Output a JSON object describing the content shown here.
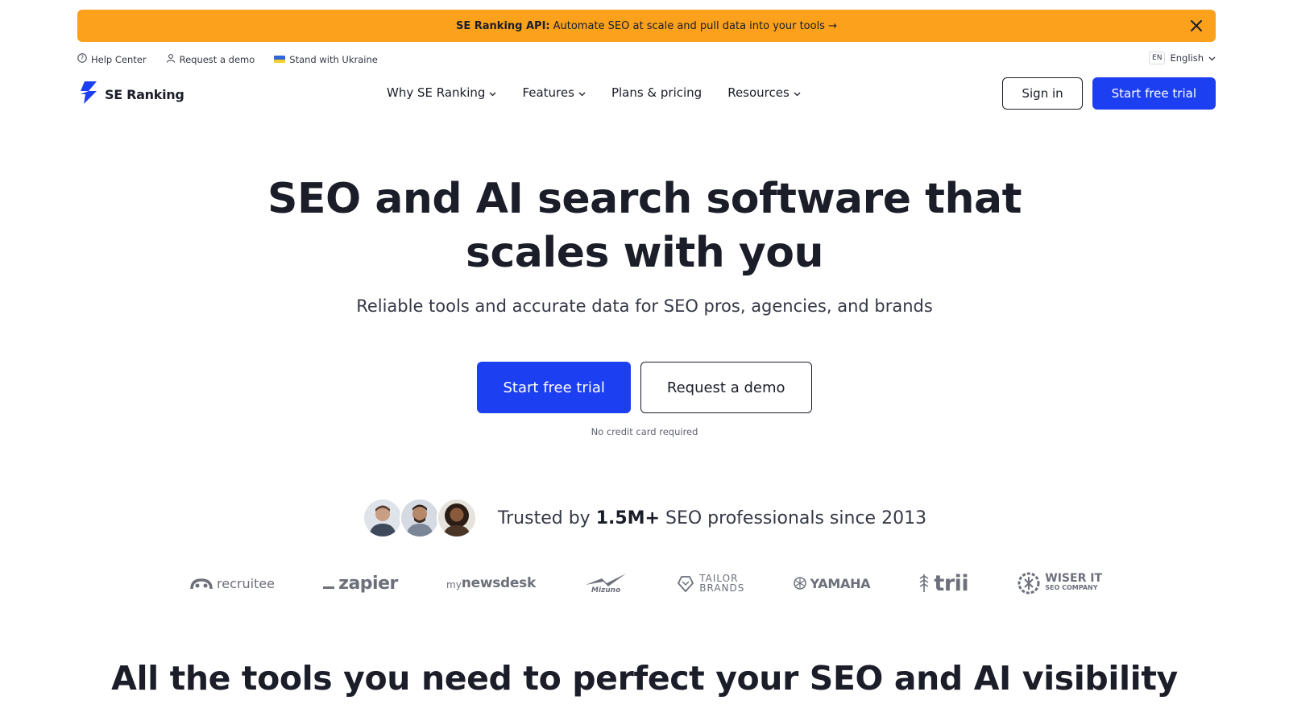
{
  "banner": {
    "strong": "SE Ranking API:",
    "text": "Automate SEO at scale and pull data into your tools →"
  },
  "utility": {
    "help_center": "Help Center",
    "request_demo": "Request a demo",
    "ukraine": "Stand with Ukraine",
    "lang_code": "EN",
    "lang_label": "English"
  },
  "nav": {
    "logo_text": "SE Ranking",
    "links": [
      {
        "label": "Why SE Ranking",
        "has_dropdown": true
      },
      {
        "label": "Features",
        "has_dropdown": true
      },
      {
        "label": "Plans & pricing",
        "has_dropdown": false
      },
      {
        "label": "Resources",
        "has_dropdown": true
      }
    ],
    "sign_in": "Sign in",
    "start_trial": "Start free trial"
  },
  "hero": {
    "title_line1": "SEO and AI search software that",
    "title_line2": "scales with you",
    "subtitle": "Reliable tools and accurate data for SEO pros, agencies, and brands",
    "primary_cta": "Start free trial",
    "secondary_cta": "Request a demo",
    "note": "No credit card required"
  },
  "trust": {
    "prefix": "Trusted by",
    "highlight": "1.5M+",
    "suffix": "SEO professionals since 2013"
  },
  "logos": {
    "recruitee": "recruitee",
    "zapier": "zapier",
    "mynewsdesk_pre": "my",
    "mynewsdesk_main": "newsdesk",
    "mizuno": "Mizuno",
    "tailor_1": "TAILOR",
    "tailor_2": "BRANDS",
    "yamaha": "YAMAHA",
    "trii": "trii",
    "wiser_1": "WISER IT",
    "wiser_2": "SEO COMPANY"
  },
  "section": {
    "title": "All the tools you need to perfect your SEO and AI visibility"
  },
  "colors": {
    "banner": "#fba11b",
    "primary": "#1d3ff2",
    "text": "#1b1d29",
    "muted": "#6d707b"
  }
}
